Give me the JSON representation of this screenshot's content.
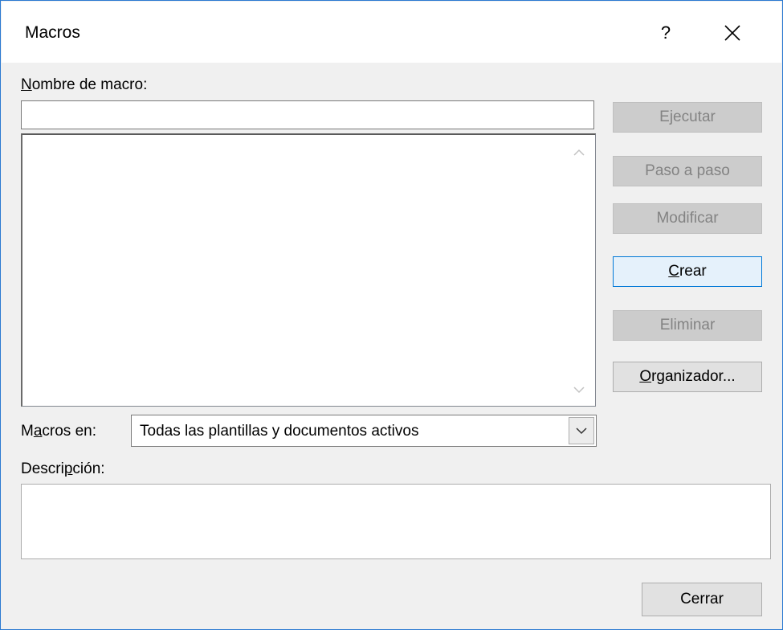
{
  "window": {
    "title": "Macros",
    "help_label": "?",
    "close_icon": "close-icon"
  },
  "form": {
    "name_label_accel": "N",
    "name_label_rest": "ombre de macro:",
    "name_value": "",
    "macros_in_label_pre": "M",
    "macros_in_label_accel": "a",
    "macros_in_label_rest": "cros en:",
    "macros_in_value": "Todas las plantillas y documentos activos",
    "description_label_pre": "Descri",
    "description_label_accel": "p",
    "description_label_rest": "ción:",
    "description_value": ""
  },
  "macro_list": {
    "items": []
  },
  "buttons": {
    "run": "Ejecutar",
    "step": "Paso a paso",
    "edit": "Modificar",
    "create_accel": "C",
    "create_rest": "rear",
    "delete": "Eliminar",
    "organizer_accel": "O",
    "organizer_rest": "rganizador...",
    "close": "Cerrar"
  },
  "colors": {
    "accent": "#0078d7",
    "border": "#2b7ad1",
    "disabled_text": "#838383"
  }
}
